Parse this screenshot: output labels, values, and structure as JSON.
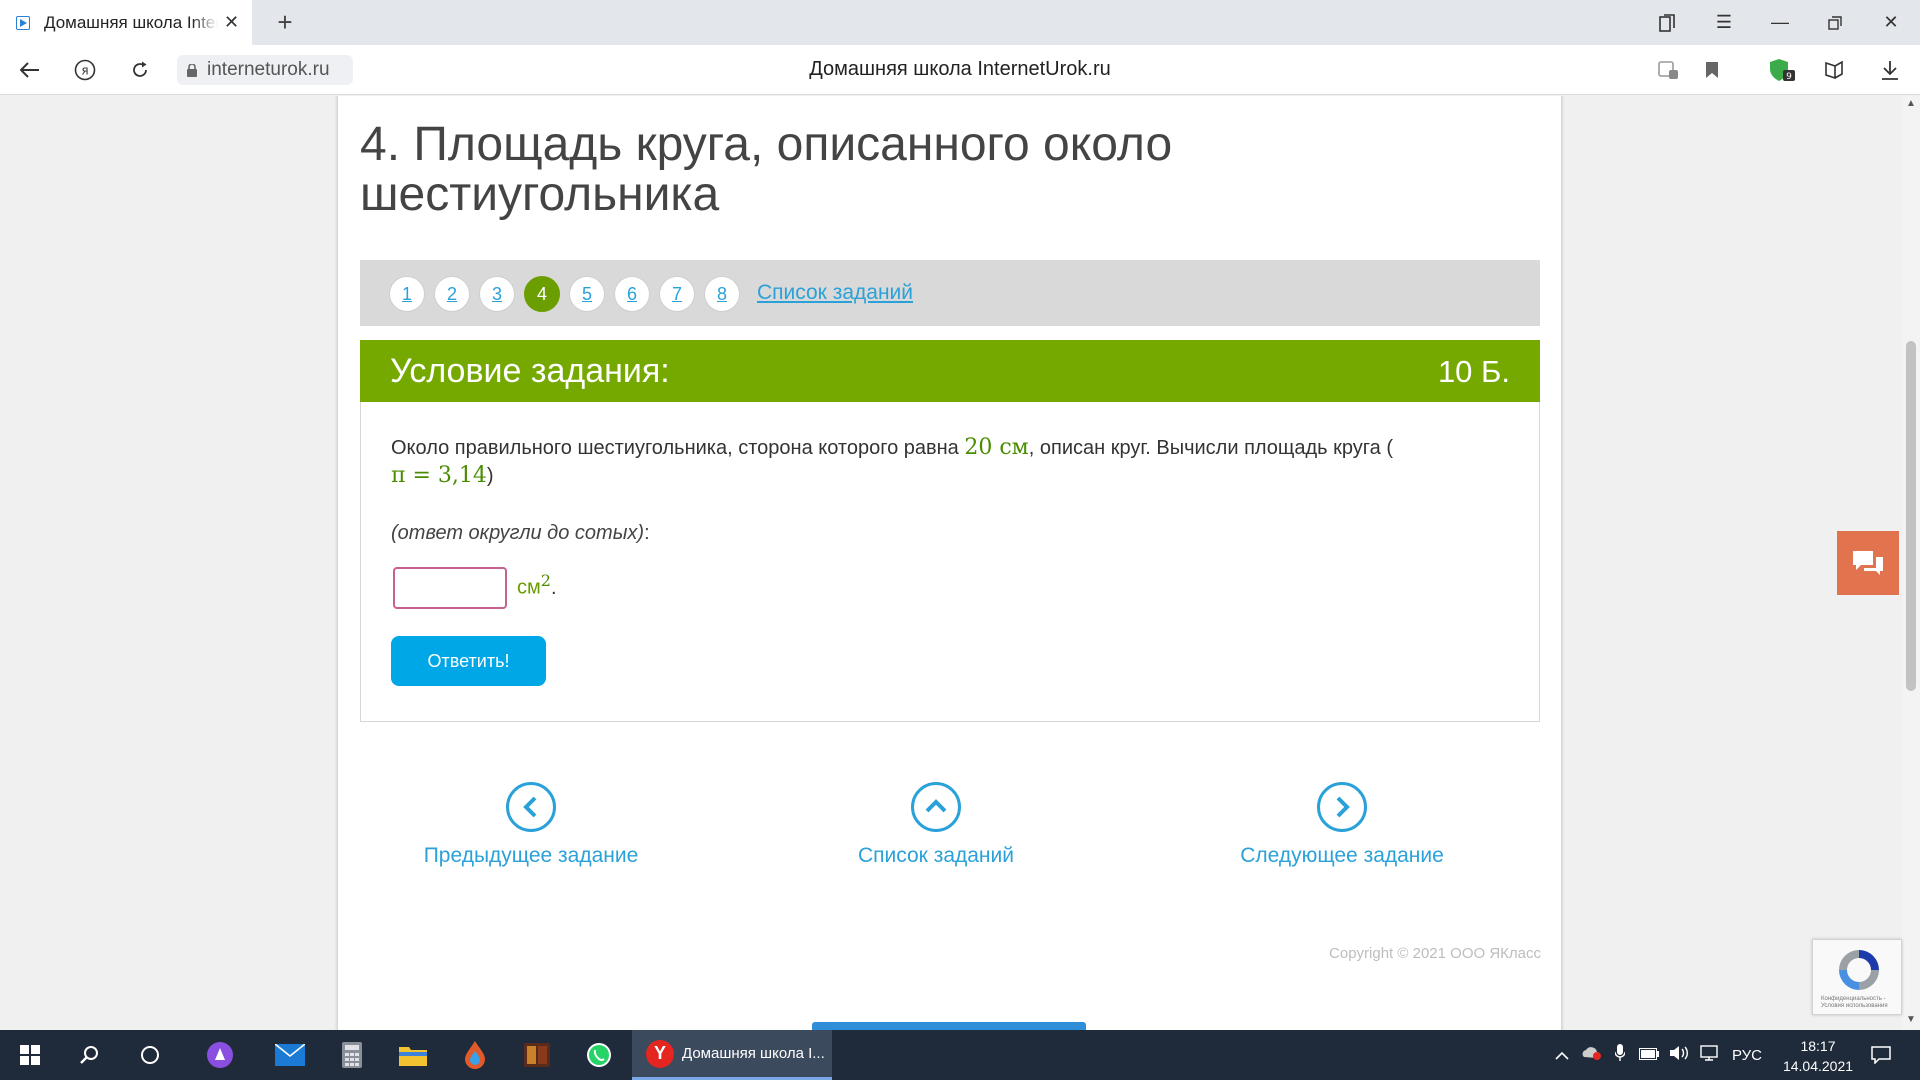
{
  "browser": {
    "tab_title": "Домашняя школа InternetUrok.ru",
    "url": "interneturok.ru",
    "page_title": "Домашняя школа InternetUrok.ru",
    "downloads_badge": "9"
  },
  "lesson": {
    "title": "4. Площадь круга, описанного около шестиугольника"
  },
  "pager": {
    "pages": [
      "1",
      "2",
      "3",
      "4",
      "5",
      "6",
      "7",
      "8"
    ],
    "active": "4",
    "list_link": "Список заданий"
  },
  "task": {
    "header_label": "Условие задания:",
    "points": "10 Б.",
    "statement_part1": "Около правильного шестиугольника, сторона которого равна ",
    "side_value": "20 см",
    "statement_part2": ", описан круг. Вычисли площадь круга (",
    "pi_expr": "π = 3,14",
    "statement_part3": ")",
    "hint": "(ответ округли до сотых)",
    "hint_colon": ":",
    "answer_value": "",
    "unit": "см",
    "unit_exp": "2",
    "unit_dot": ".",
    "submit_label": "Ответить!"
  },
  "navigation": {
    "prev": "Предыдущее задание",
    "list": "Список заданий",
    "next": "Следующее задание"
  },
  "footer": {
    "copyright": "Copyright © 2021 ООО ЯКласс"
  },
  "recaptcha": {
    "text": "Конфиденциальность - Условия использования"
  },
  "taskbar": {
    "active_app_label": "Домашняя школа I...",
    "language": "РУС",
    "time": "18:17",
    "date": "14.04.2021"
  },
  "colors": {
    "accent_green": "#75a900",
    "active_page": "#6b9e00",
    "link_blue": "#2aa1d8",
    "submit_blue": "#00a7e6",
    "chat_orange": "#e2734f"
  }
}
